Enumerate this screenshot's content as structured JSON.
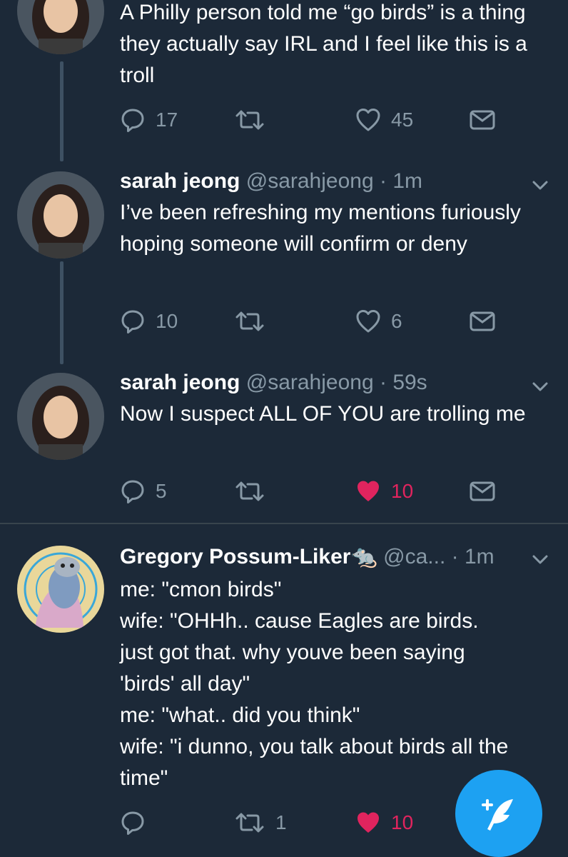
{
  "tweets": [
    {
      "name": "",
      "handle": "",
      "time": "",
      "text": "A Philly person told me “go birds” is a thing they actually say IRL and I feel like this is a troll",
      "replies": "17",
      "retweets": "",
      "likes": "45",
      "liked": false
    },
    {
      "name": "sarah jeong",
      "handle": "@sarahjeong",
      "time": "1m",
      "text": "I’ve been refreshing my mentions furiously hoping someone will confirm or deny",
      "replies": "10",
      "retweets": "",
      "likes": "6",
      "liked": false
    },
    {
      "name": "sarah jeong",
      "handle": "@sarahjeong",
      "time": "59s",
      "text": "Now I suspect ALL OF YOU are trolling me",
      "replies": "5",
      "retweets": "",
      "likes": "10",
      "liked": true
    },
    {
      "name": "Gregory Possum-Liker🐀",
      "handle": "@ca...",
      "time": "1m",
      "lines": [
        "me: \"cmon birds\"",
        "wife: \"OHHh.. cause Eagles are birds.",
        "just got that. why youve been saying",
        "'birds' all day\"",
        "me: \"what.. did you think\"",
        "wife: \"i dunno, you talk about birds all the",
        "time\""
      ],
      "replies": "",
      "retweets": "1",
      "likes": "10",
      "liked": true
    }
  ],
  "compose": {
    "icon": "compose-tweet-icon"
  },
  "colors": {
    "background": "#1c2938",
    "secondary": "#8899a6",
    "like": "#e0245e",
    "accent": "#1da1f2"
  }
}
